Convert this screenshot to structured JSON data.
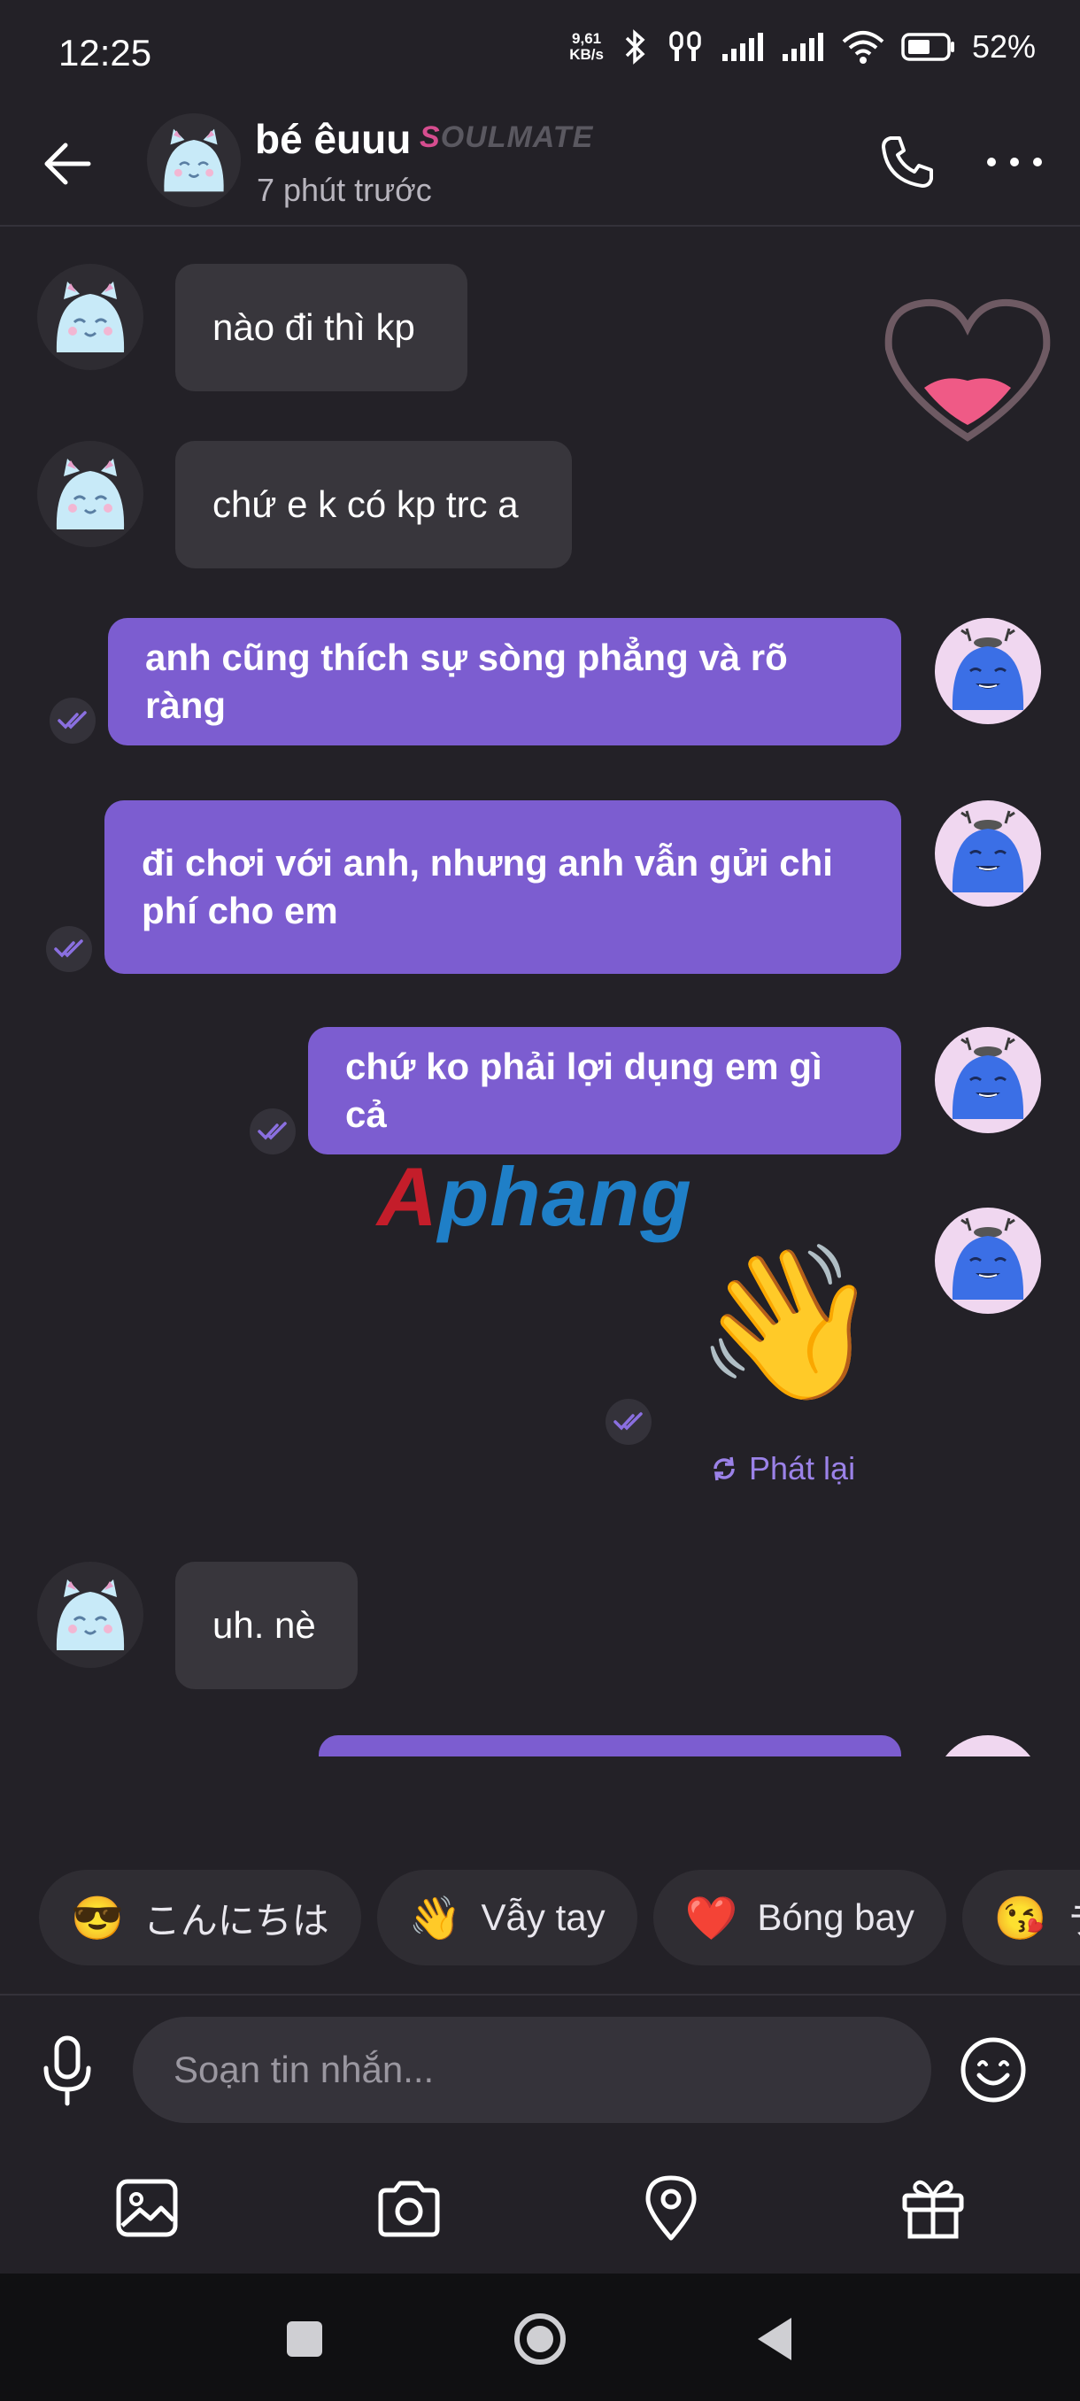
{
  "status_bar": {
    "time": "12:25",
    "net_speed_value": "9,61",
    "net_speed_unit": "KB/s",
    "battery": "52%"
  },
  "header": {
    "name": "bé êuuu",
    "badge_initial": "S",
    "badge_rest": "OULMATE",
    "status": "7 phút trước",
    "icons": [
      "back-arrow-icon",
      "phone-icon",
      "more-icon"
    ]
  },
  "messages": [
    {
      "from": "them",
      "text": "nào đi thì kp"
    },
    {
      "from": "them",
      "text": "chứ e k có kp trc a"
    },
    {
      "from": "me",
      "text": "anh cũng thích sự sòng phẳng và rõ ràng",
      "read": true
    },
    {
      "from": "me",
      "line1": "đi chơi với anh, nhưng anh vẫn gửi chi",
      "line2": "phí cho em",
      "read": true
    },
    {
      "from": "me",
      "text": "chứ ko phải lợi dụng em gì cả",
      "read": true
    },
    {
      "from": "me",
      "emoji": "👋",
      "read": true
    },
    {
      "from": "them",
      "text": "uh. nè"
    }
  ],
  "replay_label": "Phát lại",
  "watermark": {
    "part1": "A",
    "part2": "phang"
  },
  "quick_replies": [
    {
      "emoji": "😎",
      "label": "こんにちは"
    },
    {
      "emoji": "👋",
      "label": "Vẫy tay"
    },
    {
      "emoji": "❤️",
      "label": "Bóng bay"
    },
    {
      "emoji": "😘",
      "label": "ラ"
    }
  ],
  "composer": {
    "placeholder": "Soạn tin nhắn..."
  },
  "colors": {
    "background": "#232127",
    "outgoing_bubble": "#7c5dd0",
    "incoming_bubble": "#38363c",
    "accent": "#9b82e8"
  }
}
